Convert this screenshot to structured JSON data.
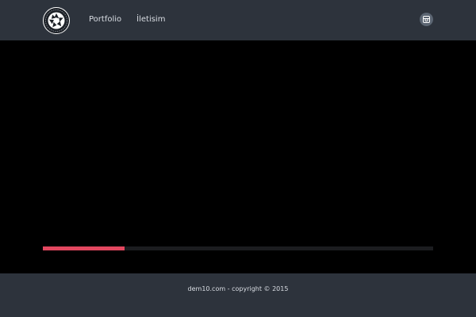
{
  "header": {
    "nav": [
      {
        "label": "Portfolio"
      },
      {
        "label": "İletisim"
      }
    ],
    "logo_icon": "camera-aperture-icon",
    "social_icon": "instagram-icon"
  },
  "slider": {
    "progress_fraction": 0.21,
    "progress_color": "#e2475f"
  },
  "footer": {
    "copyright": "dem10.com - copyright © 2015"
  }
}
